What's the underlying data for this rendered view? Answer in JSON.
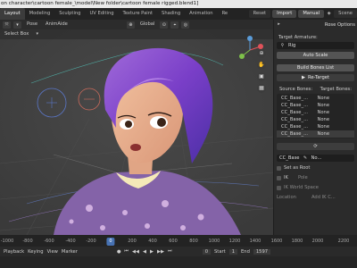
{
  "window": {
    "title": "on character\\cartoon female_\\model\\New folder\\cartoon female rigged.blend1]"
  },
  "topbar": {
    "tabs": [
      "Layout",
      "Modeling",
      "Sculpting",
      "UV Editing",
      "Texture Paint",
      "Shading",
      "Animation",
      "Re"
    ],
    "active_tab": "Layout",
    "right": {
      "reset": "Reset",
      "import": "Import",
      "manual": "Manual",
      "scene": "Scene"
    }
  },
  "viewport_header": {
    "mode_icon": "pose-mode-icon",
    "transform": "Global",
    "items": [
      "Pose",
      "AnimAide"
    ],
    "select": "Select Box"
  },
  "right_panel": {
    "header_label": "Rose Options",
    "target_armature_label": "Target Armature:",
    "target_armature_value": "Rig",
    "auto_scale": "Auto Scale",
    "build_bones_list": "Build Bones List",
    "re_target": "Re-Target",
    "source_bones_label": "Source Bones:",
    "target_bones_label": "Target Bones:",
    "bones": [
      {
        "source": "CC_Base_...",
        "target": "None"
      },
      {
        "source": "CC_Base_...",
        "target": "None"
      },
      {
        "source": "CC_Base_...",
        "target": "None"
      },
      {
        "source": "CC_Base_...",
        "target": "None"
      },
      {
        "source": "CC_Base_...",
        "target": "None"
      },
      {
        "source": "CC_Base_...",
        "target": "None"
      }
    ],
    "bone_field": "CC_Base",
    "bone_field_right": "No...",
    "set_as_root": "Set as Root",
    "ik_label": "IK",
    "ik_pole": "Pole",
    "ik_world_space": "IK World Space",
    "location": "Location",
    "add_ik": "Add IK C..."
  },
  "timeline": {
    "header_items": [
      "Playback",
      "Keying",
      "View",
      "Marker"
    ],
    "ticks": [
      "-1000",
      "-800",
      "-600",
      "-400",
      "-200",
      "0",
      "200",
      "400",
      "600",
      "800",
      "1000",
      "1200",
      "1400",
      "1600",
      "1800",
      "2000",
      "2200"
    ],
    "current_frame": "0",
    "start_label": "Start",
    "start_value": "1",
    "end_label": "End",
    "end_value": "1597"
  }
}
